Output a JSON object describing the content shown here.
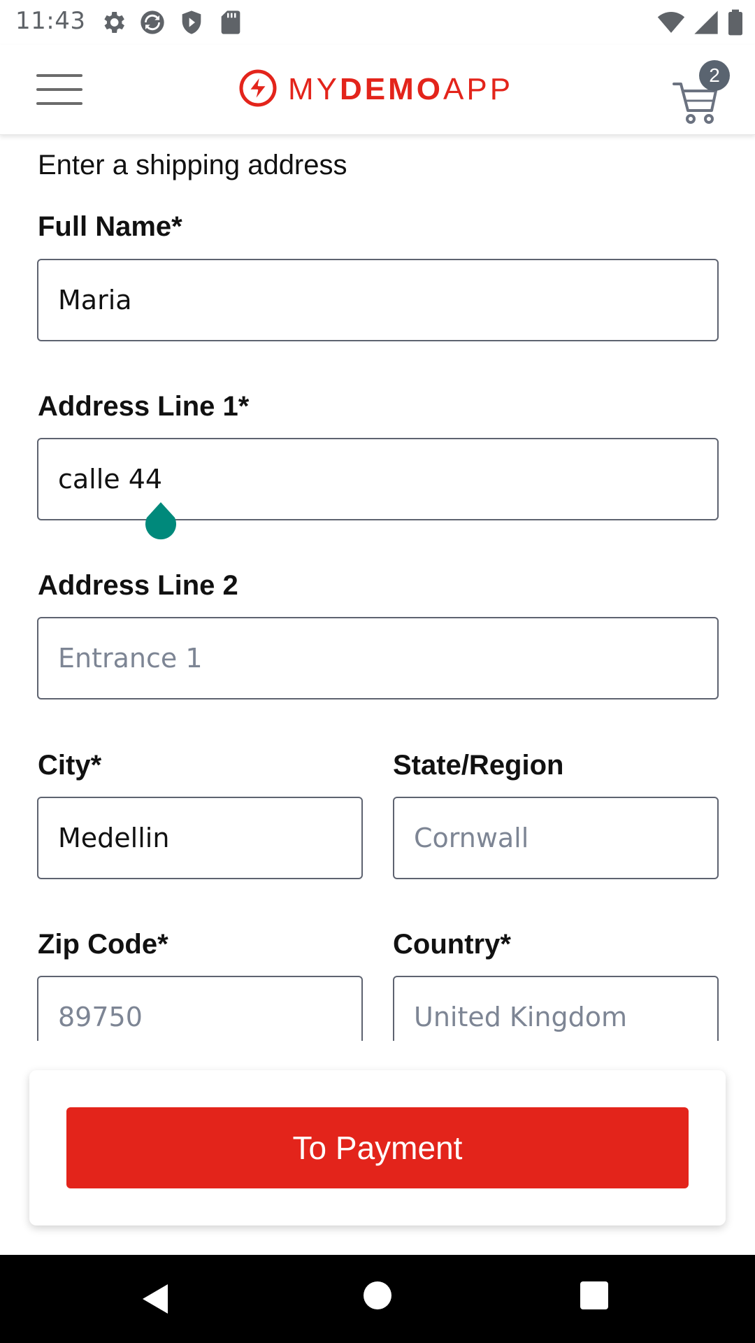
{
  "status_bar": {
    "time": "11:43",
    "left_icons": [
      "settings-icon",
      "sync-icon",
      "shield-icon",
      "sd-card-icon"
    ],
    "right_icons": [
      "wifi-icon",
      "cell-signal-icon",
      "battery-icon"
    ]
  },
  "header": {
    "logo": {
      "prefix": "MY",
      "middle": "DEMO",
      "suffix": "APP"
    },
    "cart_count": "2",
    "menu_icon": "hamburger-menu-icon",
    "cart_icon": "shopping-cart-icon"
  },
  "form": {
    "title": "Enter a shipping address",
    "full_name": {
      "label": "Full Name*",
      "value": "Maria",
      "placeholder": ""
    },
    "address_line_1": {
      "label": "Address Line 1*",
      "value": "calle 44",
      "placeholder": ""
    },
    "address_line_2": {
      "label": "Address Line 2",
      "value": "",
      "placeholder": "Entrance 1"
    },
    "city": {
      "label": "City*",
      "value": "Medellin",
      "placeholder": ""
    },
    "state": {
      "label": "State/Region",
      "value": "",
      "placeholder": "Cornwall"
    },
    "zip": {
      "label": "Zip Code*",
      "value": "",
      "placeholder": "89750"
    },
    "country": {
      "label": "Country*",
      "value": "",
      "placeholder": "United Kingdom"
    }
  },
  "payment_button": {
    "label": "To Payment"
  },
  "colors": {
    "brand_red": "#e3241b",
    "badge_gray": "#5a6470",
    "input_border": "#5e6370",
    "cursor_handle": "#00897b"
  },
  "nav_bar": {
    "icons": [
      "back-icon",
      "home-icon",
      "recents-icon"
    ]
  }
}
